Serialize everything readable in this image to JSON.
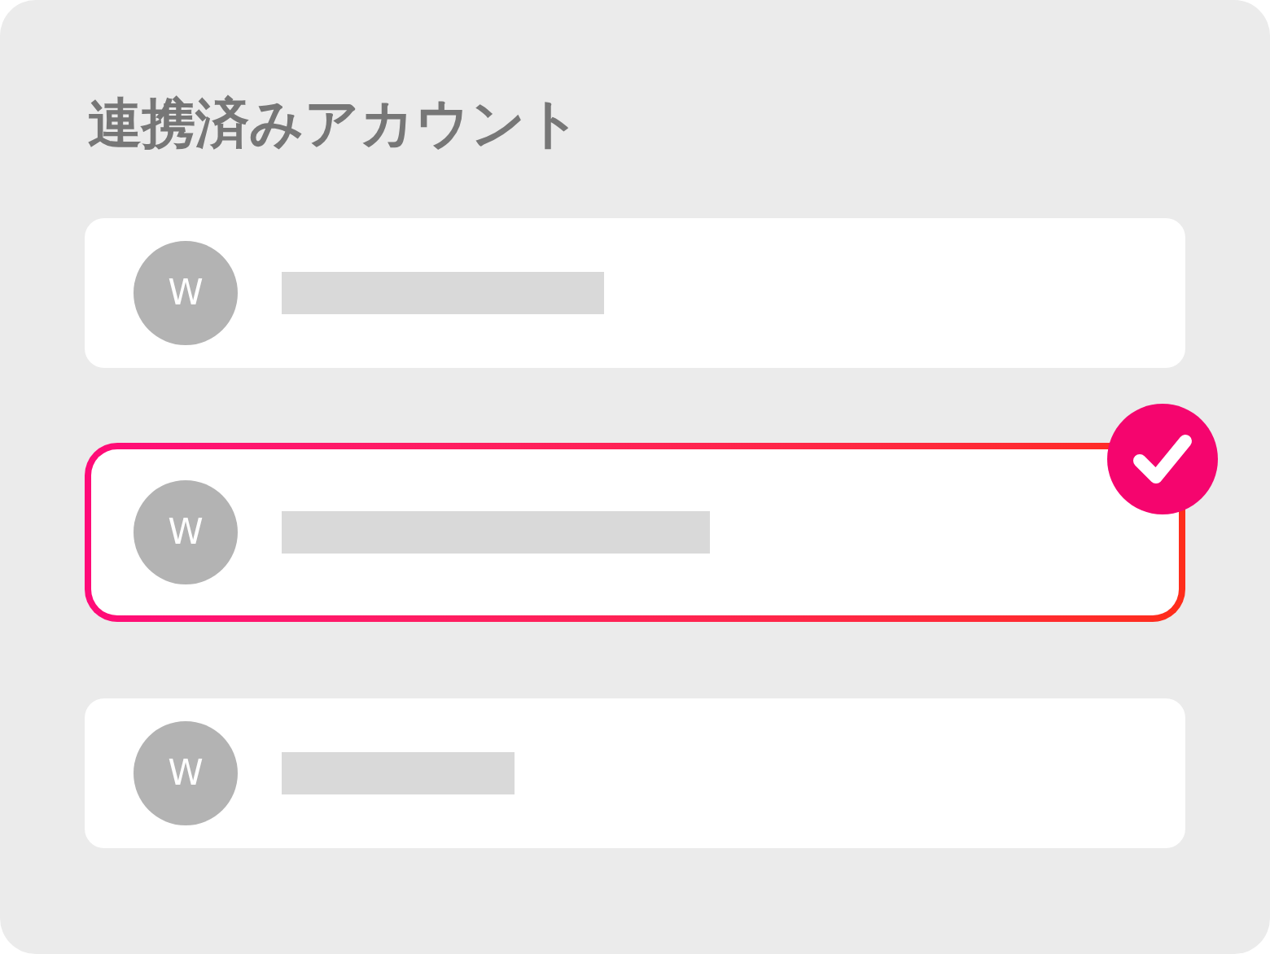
{
  "title": "連携済みアカウント",
  "accounts": [
    {
      "avatar": "W",
      "selected": false
    },
    {
      "avatar": "W",
      "selected": true
    },
    {
      "avatar": "W",
      "selected": false
    }
  ]
}
